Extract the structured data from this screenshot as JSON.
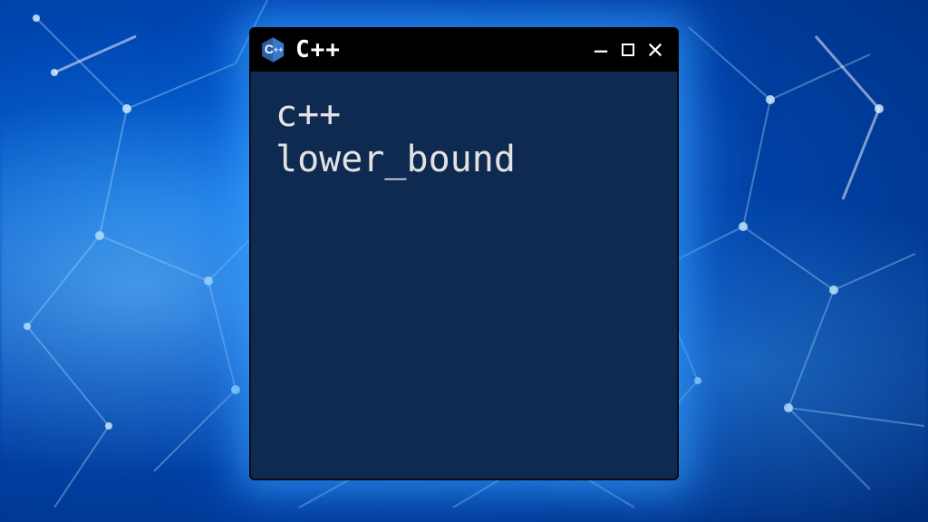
{
  "titlebar": {
    "title": "C++",
    "logo_name": "cpp-logo"
  },
  "body": {
    "line1": "c++",
    "line2": "lower_bound"
  },
  "colors": {
    "window_bg": "#0f2a50",
    "titlebar_bg": "#000000",
    "text": "#e2e2e2",
    "glow": "#3caaff"
  }
}
